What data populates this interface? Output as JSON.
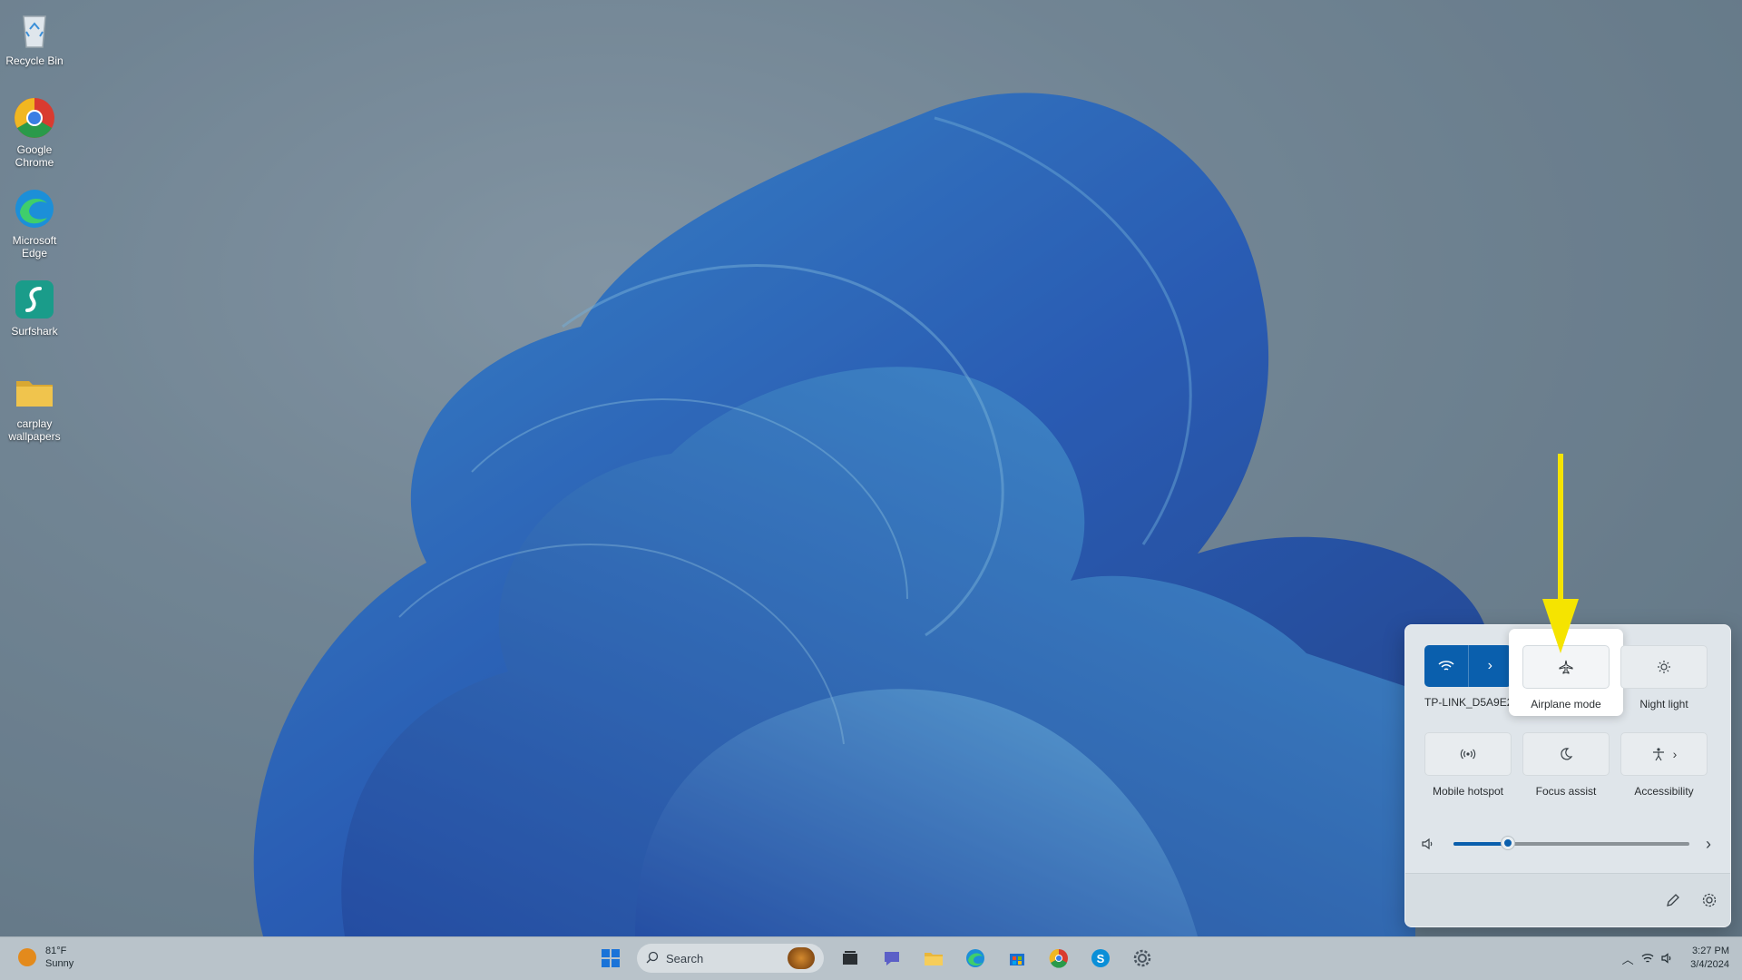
{
  "desktop": {
    "icons": [
      {
        "label": "Recycle Bin"
      },
      {
        "label": "Google Chrome"
      },
      {
        "label": "Microsoft Edge"
      },
      {
        "label": "Surfshark"
      },
      {
        "label": "carplay wallpapers"
      }
    ]
  },
  "quick_settings": {
    "tiles": [
      {
        "label": "TP-LINK_D5A9E2",
        "icon": "wifi-icon",
        "active": true
      },
      {
        "label": "Airplane mode",
        "icon": "airplane-icon",
        "active": false
      },
      {
        "label": "Night light",
        "icon": "brightness-icon",
        "active": false
      },
      {
        "label": "Mobile hotspot",
        "icon": "hotspot-icon",
        "active": false
      },
      {
        "label": "Focus assist",
        "icon": "moon-icon",
        "active": false
      },
      {
        "label": "Accessibility",
        "icon": "accessibility-icon",
        "active": false
      }
    ],
    "volume_level": 0.23,
    "accent_color": "#0a5fad"
  },
  "taskbar": {
    "weather": {
      "temp": "81°F",
      "condition": "Sunny"
    },
    "search_placeholder": "Search",
    "clock": {
      "time": "3:27 PM",
      "date": "3/4/2024"
    }
  },
  "annotation": {
    "arrow_color": "#f5e400"
  }
}
